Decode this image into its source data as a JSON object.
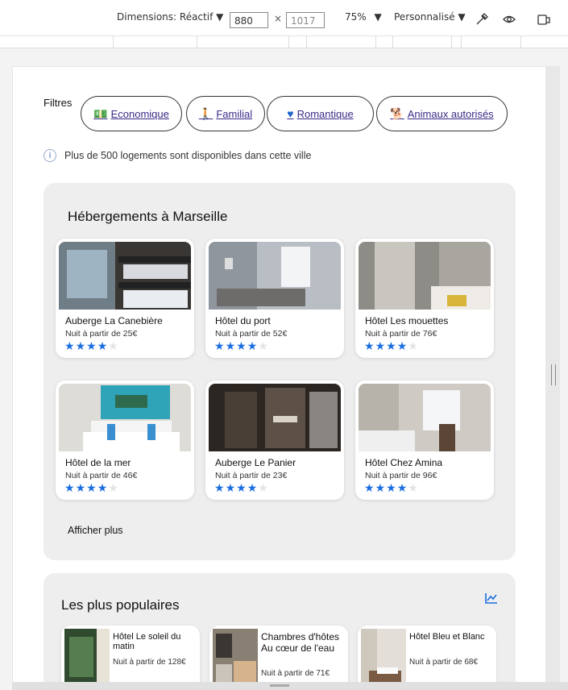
{
  "devtools": {
    "dimensions_label": "Dimensions: Réactif",
    "width": "880",
    "height": "1017",
    "zoom": "75%",
    "throttle": "Personnalisé"
  },
  "filters": {
    "label": "Filtres",
    "chips": [
      {
        "label": "Economique",
        "icon": "money-icon"
      },
      {
        "label": "Familial",
        "icon": "person-icon"
      },
      {
        "label": "Romantique",
        "icon": "heart-icon"
      },
      {
        "label": "Animaux autorisés",
        "icon": "dog-icon"
      }
    ]
  },
  "info": {
    "icon": "info-icon",
    "text": "Plus de 500 logements sont disponibles dans cette ville"
  },
  "lodging": {
    "title": "Hébergements à Marseille",
    "more": "Afficher plus",
    "cards": [
      {
        "name": "Auberge La Canebière",
        "price": "Nuit à partir de 25€",
        "rating": 4
      },
      {
        "name": "Hôtel du port",
        "price": "Nuit à partir de 52€",
        "rating": 4
      },
      {
        "name": "Hôtel Les mouettes",
        "price": "Nuit à partir de 76€",
        "rating": 4
      },
      {
        "name": "Hôtel de la mer",
        "price": "Nuit à partir de 46€",
        "rating": 4
      },
      {
        "name": "Auberge Le Panier",
        "price": "Nuit à partir de 23€",
        "rating": 4
      },
      {
        "name": "Hôtel Chez Amina",
        "price": "Nuit à partir de 96€",
        "rating": 4
      }
    ]
  },
  "popular": {
    "title": "Les plus populaires",
    "icon": "trend-chart-icon",
    "cards": [
      {
        "name": "Hôtel Le soleil du matin",
        "price": "Nuit à partir de 128€"
      },
      {
        "name": "Chambres d'hôtes Au cœur de l'eau",
        "price": "Nuit à partir de 71€"
      },
      {
        "name": "Hôtel Bleu et Blanc",
        "price": "Nuit à partir de 68€"
      }
    ]
  },
  "colors": {
    "accent": "#1a6ee0",
    "chip_text": "#3a2a87",
    "panel": "#eeeeee"
  }
}
